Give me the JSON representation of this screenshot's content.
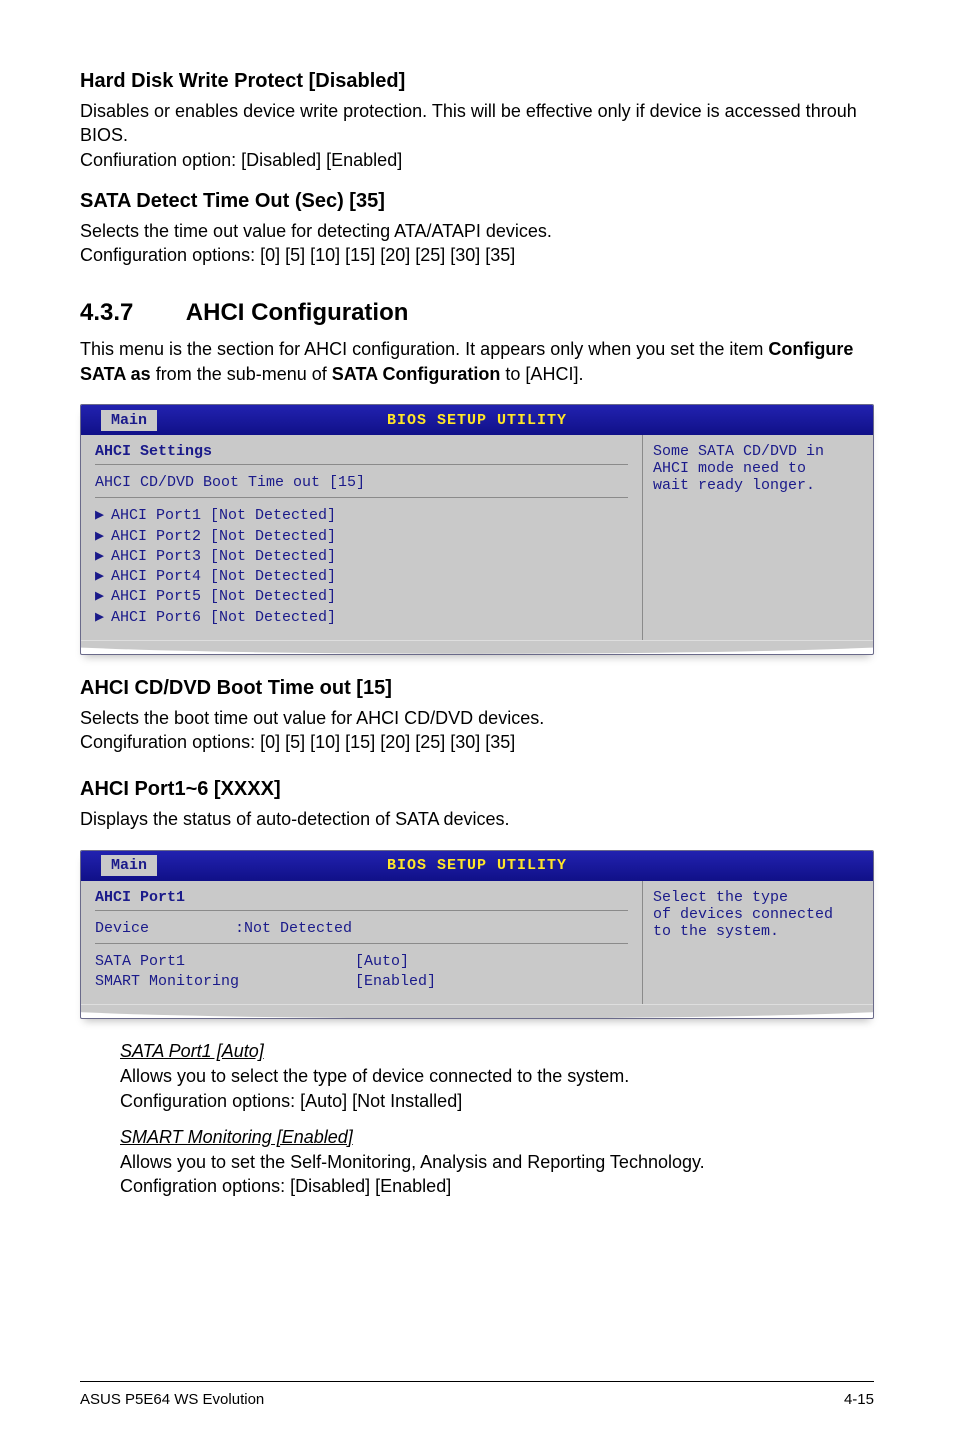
{
  "sections": {
    "hardDisk": {
      "title": "Hard Disk Write Protect [Disabled]",
      "p1": "Disables or enables device write protection. This will be effective only if device is accessed throuh BIOS.",
      "p2": "Confiuration option: [Disabled] [Enabled]"
    },
    "sataDetect": {
      "title": "SATA Detect Time Out (Sec) [35]",
      "p1": "Selects the time out value for detecting ATA/ATAPI devices.",
      "p2": "Configuration options: [0] [5] [10] [15] [20] [25] [30] [35]"
    },
    "ahciConfig": {
      "num": "4.3.7",
      "title": "AHCI Configuration",
      "intro_pre": "This menu is the section for AHCI configuration. It appears only when you set the item ",
      "intro_b1": "Configure SATA as",
      "intro_mid": " from the sub-menu of ",
      "intro_b2": "SATA Configuration",
      "intro_post": " to [AHCI]."
    },
    "ahciBoot": {
      "title": "AHCI CD/DVD Boot Time out [15]",
      "p1": "Selects the boot time out value for AHCI CD/DVD devices.",
      "p2": "Congifuration options: [0] [5] [10] [15] [20] [25] [30] [35]"
    },
    "ahciPorts": {
      "title": "AHCI Port1~6 [XXXX]",
      "p1": "Displays the status of auto-detection of SATA devices."
    },
    "sataPort1": {
      "title": "SATA Port1 [Auto]",
      "p1": "Allows you to select the type of device connected to the system.",
      "p2": "Configuration options: [Auto] [Not Installed]"
    },
    "smartMon": {
      "title": "SMART Monitoring [Enabled]",
      "p1": "Allows you to set the Self-Monitoring, Analysis and Reporting Technology.",
      "p2": "Configration options: [Disabled] [Enabled]"
    }
  },
  "bios1": {
    "headerTitle": "BIOS SETUP UTILITY",
    "tab": "Main",
    "panelTitle": "AHCI Settings",
    "mainLine": "AHCI CD/DVD Boot Time out [15]",
    "ports": [
      "AHCI Port1 [Not Detected]",
      "AHCI Port2 [Not Detected]",
      "AHCI Port3 [Not Detected]",
      "AHCI Port4 [Not Detected]",
      "AHCI Port5 [Not Detected]",
      "AHCI Port6 [Not Detected]"
    ],
    "help1": "Some SATA CD/DVD in",
    "help2": "AHCI mode need to",
    "help3": "wait ready longer."
  },
  "bios2": {
    "headerTitle": "BIOS SETUP UTILITY",
    "tab": "Main",
    "panelTitle": "AHCI Port1",
    "deviceLabel": "Device",
    "deviceValue": ":Not Detected",
    "row1k": "SATA Port1",
    "row1v": "[Auto]",
    "row2k": "SMART Monitoring",
    "row2v": "[Enabled]",
    "help1": "Select the type",
    "help2": "of devices connected",
    "help3": "to the system."
  },
  "footer": {
    "left": "ASUS P5E64 WS Evolution",
    "right": "4-15"
  }
}
